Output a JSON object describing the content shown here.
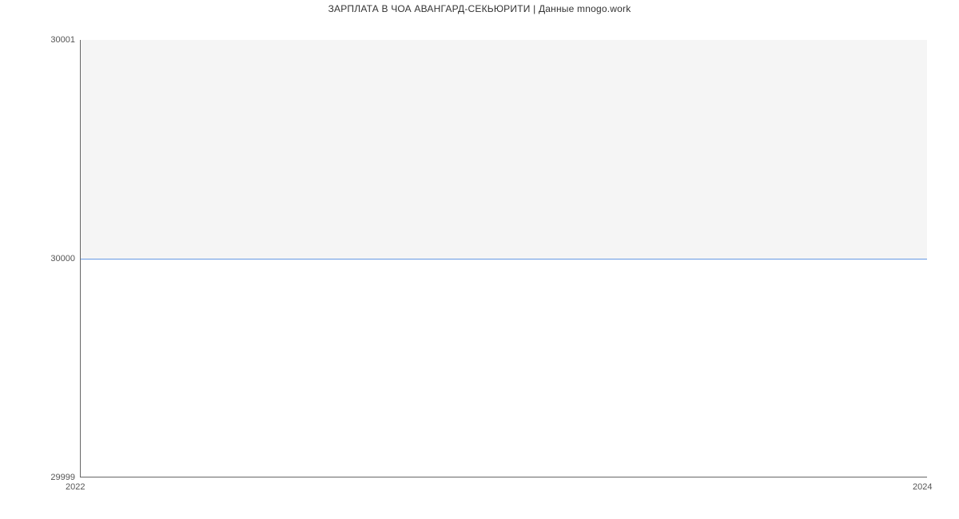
{
  "chart_data": {
    "type": "line",
    "title": "ЗАРПЛАТА В ЧОА АВАНГАРД-СЕКЬЮРИТИ | Данные mnogo.work",
    "xlabel": "",
    "ylabel": "",
    "x": [
      2022,
      2024
    ],
    "series": [
      {
        "name": "salary",
        "values": [
          30000,
          30000
        ],
        "color": "#6699e2"
      }
    ],
    "xlim": [
      2022,
      2024
    ],
    "ylim": [
      29999,
      30001
    ],
    "yticks": [
      29999,
      30000,
      30001
    ],
    "xticks": [
      2022,
      2024
    ],
    "grid": {
      "bands": true
    }
  }
}
